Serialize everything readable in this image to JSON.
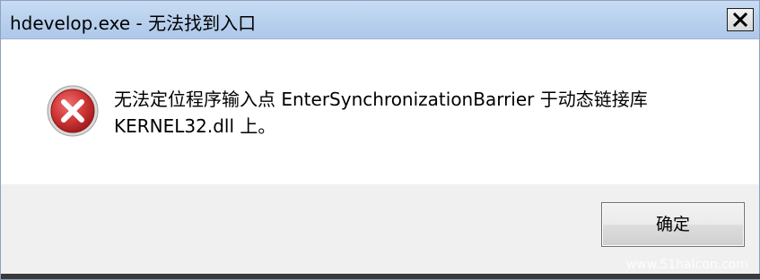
{
  "window": {
    "title": "hdevelop.exe - 无法找到入口",
    "close_icon": "close-x-icon"
  },
  "message": {
    "icon": "error-icon",
    "line1": "无法定位程序输入点 EnterSynchronizationBarrier 于动态链接库",
    "line2": "KERNEL32.dll 上。"
  },
  "buttons": {
    "ok_label": "确定"
  },
  "watermark": {
    "text": "www.51halcon.com"
  },
  "colors": {
    "title_bar": "#b9d1ee",
    "error_red": "#c0282d"
  }
}
